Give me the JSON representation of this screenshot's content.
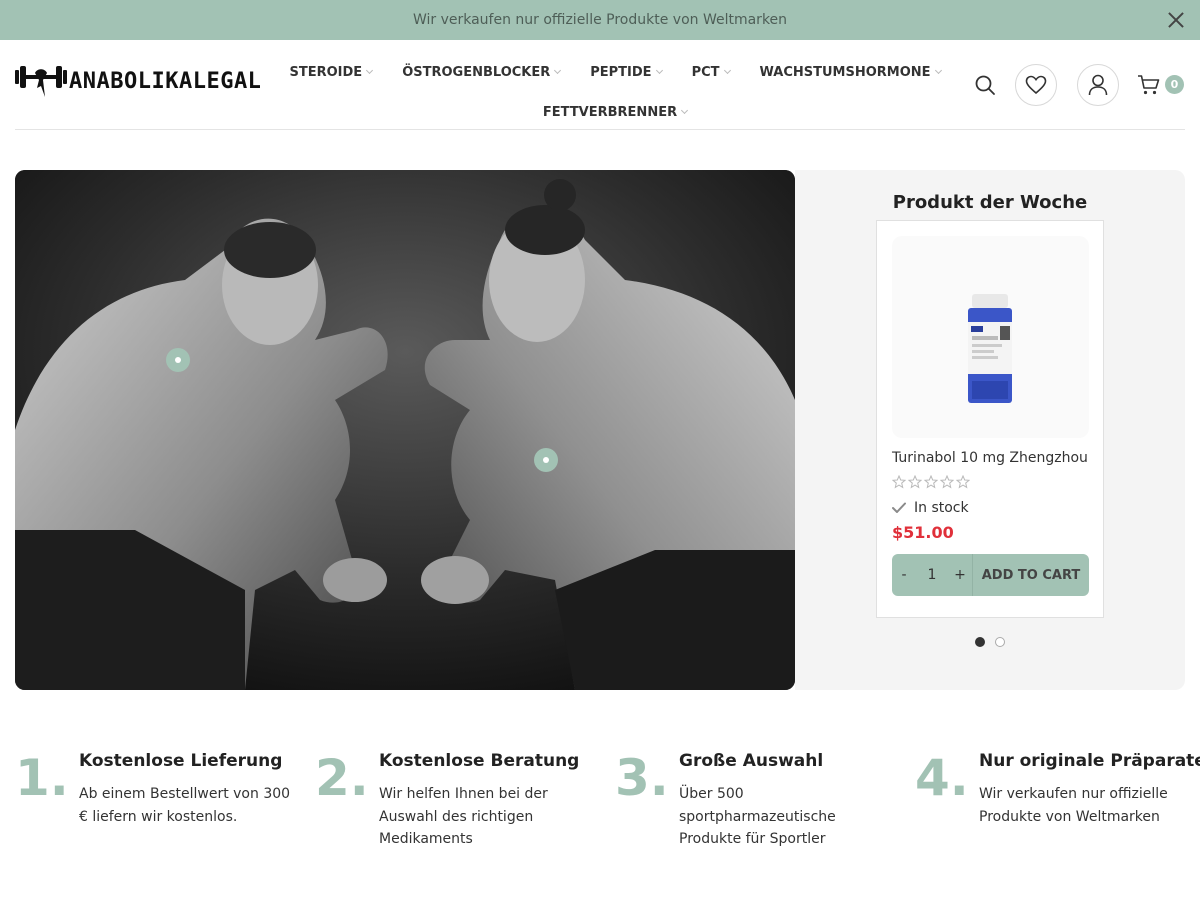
{
  "announcement": {
    "text": "Wir verkaufen nur offizielle Produkte von Weltmarken",
    "close_icon": "close-icon"
  },
  "header": {
    "logo_text": "ANABOLIKALEGAL",
    "nav_row1": [
      "STEROIDE",
      "ÖSTROGENBLOCKER",
      "PEPTIDE",
      "PCT",
      "WACHSTUMSHORMONE"
    ],
    "nav_row2": [
      "FETTVERBRENNER"
    ],
    "icons": [
      "search-icon",
      "heart-icon",
      "user-icon",
      "cart-icon"
    ],
    "cart_count": "0"
  },
  "hero": {
    "image": "black-and-white photo of two bodybuilders flexing face to face"
  },
  "product_of_week": {
    "title": "Produkt der Woche",
    "product": {
      "name": "Turinabol 10 mg Zhengzhou",
      "rating": 0,
      "rating_max": 5,
      "stock": "In stock",
      "price": "$51.00",
      "qty_minus": "-",
      "qty_value": "1",
      "qty_plus": "+",
      "add_to_cart": "ADD TO CART"
    },
    "slides_total": 2,
    "active_slide": 1
  },
  "features": [
    {
      "num": "1.",
      "title": "Kostenlose Lieferung",
      "text": "Ab einem Bestellwert von 300 € liefern wir kostenlos."
    },
    {
      "num": "2.",
      "title": "Kostenlose Beratung",
      "text": "Wir helfen Ihnen bei der Auswahl des richtigen Medikaments"
    },
    {
      "num": "3.",
      "title": "Große Auswahl",
      "text": "Über 500 sportpharmazeutische Produkte für Sportler"
    },
    {
      "num": "4.",
      "title": "Nur originale Präparate",
      "text": "Wir verkaufen nur offizielle Produkte von Weltmarken"
    }
  ],
  "colors": {
    "accent": "#a2c2b4",
    "price": "#e0303a"
  }
}
